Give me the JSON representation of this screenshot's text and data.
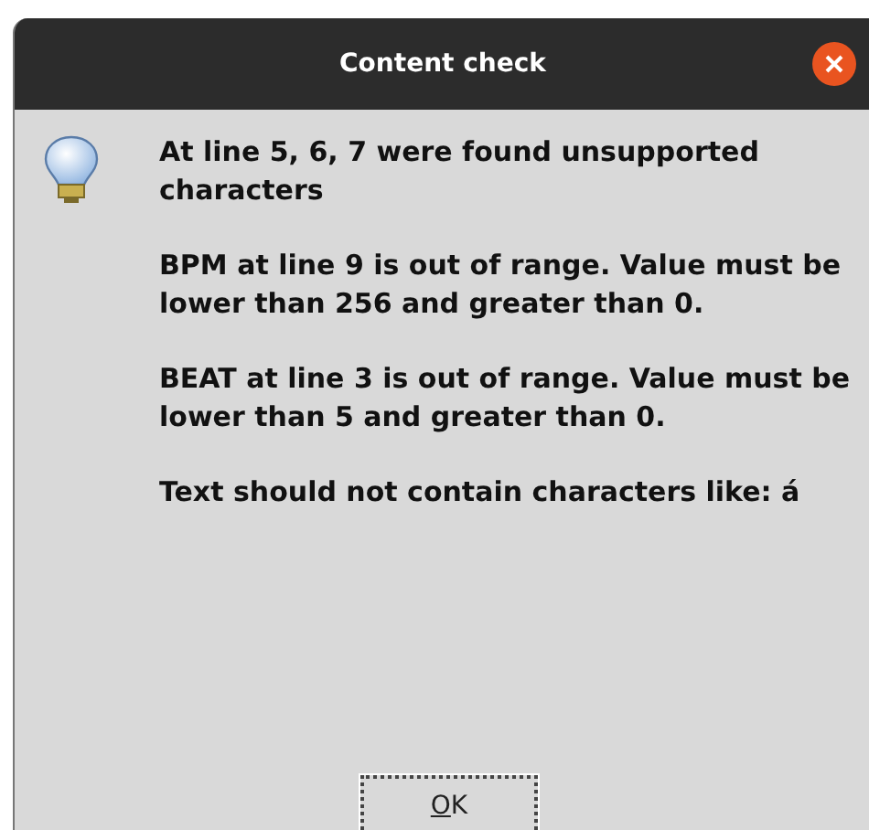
{
  "window": {
    "title": "Content check"
  },
  "messages": [
    "At line 5, 6, 7 were found unsupported characters",
    "BPM at line 9 is out of range. Value must be lower than 256 and greater than 0.",
    "BEAT at line 3 is out of range. Value must be lower than 5 and greater than 0.",
    "Text should not contain characters like: á"
  ],
  "buttons": [
    {
      "label": "OK",
      "focused": true
    }
  ]
}
